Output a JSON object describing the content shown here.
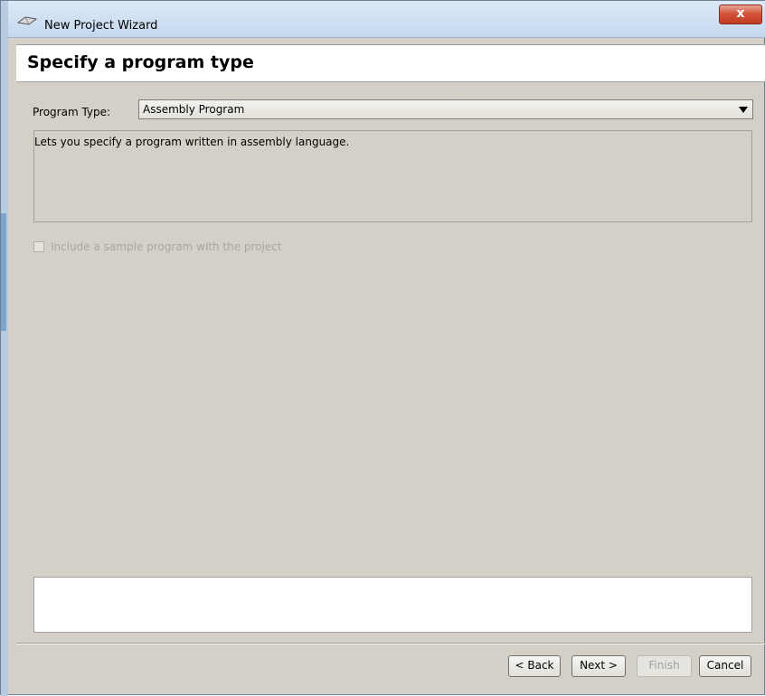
{
  "window": {
    "title": "New Project Wizard",
    "close_label": "x"
  },
  "header": {
    "page_title": "Specify a program type"
  },
  "form": {
    "program_type_label": "Program Type:",
    "program_type_value": "Assembly Program",
    "description": "Lets you specify a program written in assembly language.",
    "include_sample_label": "Include a sample program with the project",
    "include_sample_checked": false,
    "include_sample_enabled": false
  },
  "buttons": {
    "back": "< Back",
    "next": "Next >",
    "finish": "Finish",
    "cancel": "Cancel"
  },
  "colors": {
    "dialog_bg": "#d4d0c8",
    "close_button": "#c23b22",
    "titlebar": "#c4d8ee"
  }
}
